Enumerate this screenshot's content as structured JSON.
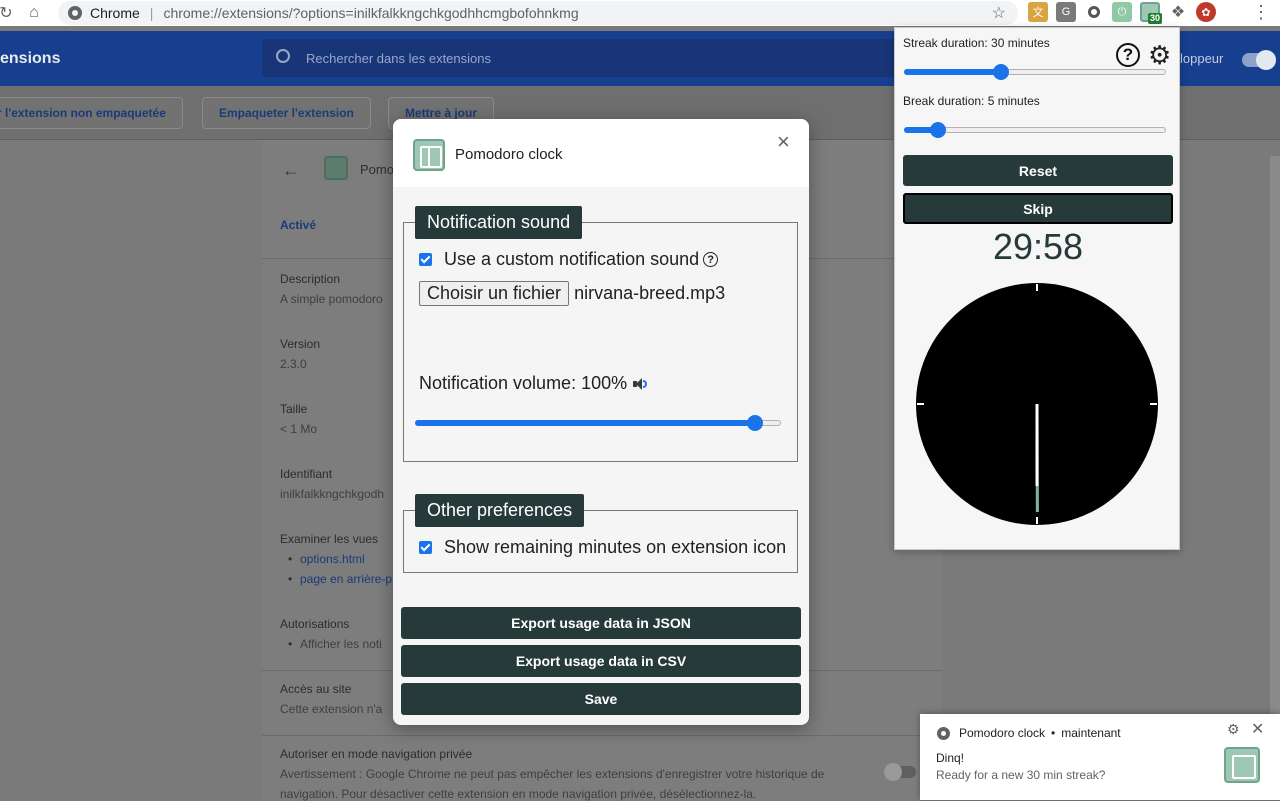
{
  "browser": {
    "tab_label": "Chrome",
    "url": "chrome://extensions/?options=inilkfalkkngchkgodhhcmgbofohnkmg",
    "extension_badge": "30"
  },
  "extensions_page": {
    "title": "ensions",
    "search_placeholder": "Rechercher dans les extensions",
    "developer_mode_label": "loppeur",
    "actions": [
      "r l'extension non empaquetée",
      "Empaqueter l'extension",
      "Mettre à jour"
    ],
    "card": {
      "name": "Pomo",
      "status": "Activé",
      "description_label": "Description",
      "description_value": "A simple pomodoro",
      "version_label": "Version",
      "version_value": "2.3.0",
      "size_label": "Taille",
      "size_value": "< 1 Mo",
      "id_label": "Identifiant",
      "id_value": "inilkfalkkngchkgodh",
      "views_label": "Examiner les vues",
      "views": [
        "options.html",
        "page en arrière-p"
      ],
      "permissions_label": "Autorisations",
      "permission_item": "Afficher les noti",
      "site_access_label": "Accès au site",
      "site_access_value": "Cette extension n'a",
      "incognito_label": "Autoriser en mode navigation privée",
      "incognito_text_1": "Avertissement : Google Chrome ne peut pas empêcher les extensions d'enregistrer votre historique de",
      "incognito_text_2": "navigation. Pour désactiver cette extension en mode navigation privée, désélectionnez-la."
    }
  },
  "options_dialog": {
    "title": "Pomodoro clock",
    "close_label": "×",
    "notification_sound": {
      "legend": "Notification sound",
      "use_custom_label": "Use a custom notification sound",
      "use_custom_checked": true,
      "help_glyph": "?",
      "file_button_label": "Choisir un fichier",
      "file_name": "nirvana-breed.mp3",
      "volume_label": "Notification volume: 100%",
      "volume_value": 100
    },
    "other_preferences": {
      "legend": "Other preferences",
      "show_minutes_label": "Show remaining minutes on extension icon",
      "show_minutes_checked": true
    },
    "buttons": {
      "export_json": "Export usage data in JSON",
      "export_csv": "Export usage data in CSV",
      "save": "Save"
    }
  },
  "popup": {
    "streak_label": "Streak duration: 30 minutes",
    "streak_fraction": 0.37,
    "break_label": "Break duration: 5 minutes",
    "break_fraction": 0.13,
    "help_glyph": "?",
    "gear_glyph": "⚙",
    "reset_label": "Reset",
    "skip_label": "Skip",
    "timer": "29:58",
    "clock": {
      "minutes_remaining": 29,
      "seconds_remaining": 58,
      "face_color": "#000000",
      "hand_color": "#ffffff",
      "progress_hand_color": "#7fb5a0"
    }
  },
  "notification": {
    "app": "Pomodoro clock",
    "dot": "•",
    "time": "maintenant",
    "title": "Dinq!",
    "body": "Ready for a new 30 min streak?"
  },
  "colors": {
    "accent": "#1a73e8",
    "dark_button": "#263a3a"
  }
}
